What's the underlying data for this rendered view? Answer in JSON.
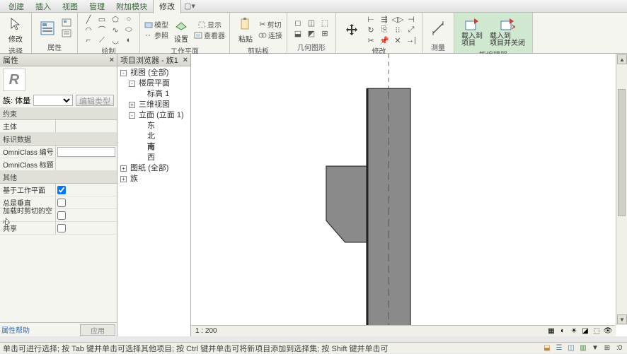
{
  "menu": {
    "items": [
      "创建",
      "插入",
      "视图",
      "管理",
      "附加模块",
      "修改"
    ],
    "active_index": 5
  },
  "ribbon": {
    "groups": {
      "select": {
        "label": "选择",
        "modify_btn": "修改"
      },
      "properties": {
        "label": "属性"
      },
      "clipboard_extra": {
        "label": "绘制"
      },
      "workplane": {
        "label": "工作平面",
        "set_btn": "设置",
        "show_btn": "显示",
        "viewer_btn": "查看器",
        "model_btn": "模型",
        "ref_btn": "参照"
      },
      "clipboard": {
        "label": "剪贴板",
        "paste_btn": "粘贴",
        "cut_btn": "剪切",
        "join_btn": "连接"
      },
      "geometry": {
        "label": "几何图形"
      },
      "modify": {
        "label": "修改"
      },
      "measure": {
        "label": "测量"
      },
      "editor": {
        "label": "族编辑器",
        "load_project": "载入到\n项目",
        "load_close": "载入到\n项目并关闭"
      }
    }
  },
  "properties": {
    "title": "属性",
    "family_label": "族: 体量",
    "edit_type_btn": "编辑类型",
    "sections": {
      "constraints": "约束",
      "ident": "标识数据",
      "other": "其他"
    },
    "rows": {
      "host": {
        "label": "主体",
        "value": ""
      },
      "omni_num": {
        "label": "OmniClass 编号",
        "value": ""
      },
      "omni_title": {
        "label": "OmniClass 标题",
        "value": ""
      },
      "workplane_based": {
        "label": "基于工作平面",
        "checked": true
      },
      "always_vertical": {
        "label": "总是垂直",
        "checked": false
      },
      "cut_with_voids": {
        "label": "加载时剪切的空心",
        "checked": false
      },
      "shared": {
        "label": "共享",
        "checked": false
      }
    },
    "help_link": "属性帮助",
    "apply_btn": "应用"
  },
  "tree": {
    "title": "项目浏览器 - 族1",
    "nodes": [
      {
        "indent": 0,
        "toggle": "-",
        "label": "视图 (全部)",
        "bold": false
      },
      {
        "indent": 1,
        "toggle": "-",
        "label": "楼层平面",
        "bold": false
      },
      {
        "indent": 2,
        "toggle": "",
        "label": "标高 1",
        "bold": false
      },
      {
        "indent": 1,
        "toggle": "+",
        "label": "三维视图",
        "bold": false
      },
      {
        "indent": 1,
        "toggle": "-",
        "label": "立面 (立面 1)",
        "bold": false
      },
      {
        "indent": 2,
        "toggle": "",
        "label": "东",
        "bold": false
      },
      {
        "indent": 2,
        "toggle": "",
        "label": "北",
        "bold": false
      },
      {
        "indent": 2,
        "toggle": "",
        "label": "南",
        "bold": true
      },
      {
        "indent": 2,
        "toggle": "",
        "label": "西",
        "bold": false
      },
      {
        "indent": 0,
        "toggle": "+",
        "label": "图纸 (全部)",
        "bold": false
      },
      {
        "indent": 0,
        "toggle": "+",
        "label": "族",
        "bold": false
      }
    ]
  },
  "canvas": {
    "scale": "1 : 200"
  },
  "status": {
    "text": "单击可进行选择; 按 Tab 键并单击可选择其他项目; 按 Ctrl 键并单击可将新项目添加到选择集; 按 Shift 键并单击可"
  },
  "colors": {
    "accent_green": "#3a8a3a",
    "panel_bg": "#f5f5f0",
    "editor_bg": "#d0e8d0"
  }
}
